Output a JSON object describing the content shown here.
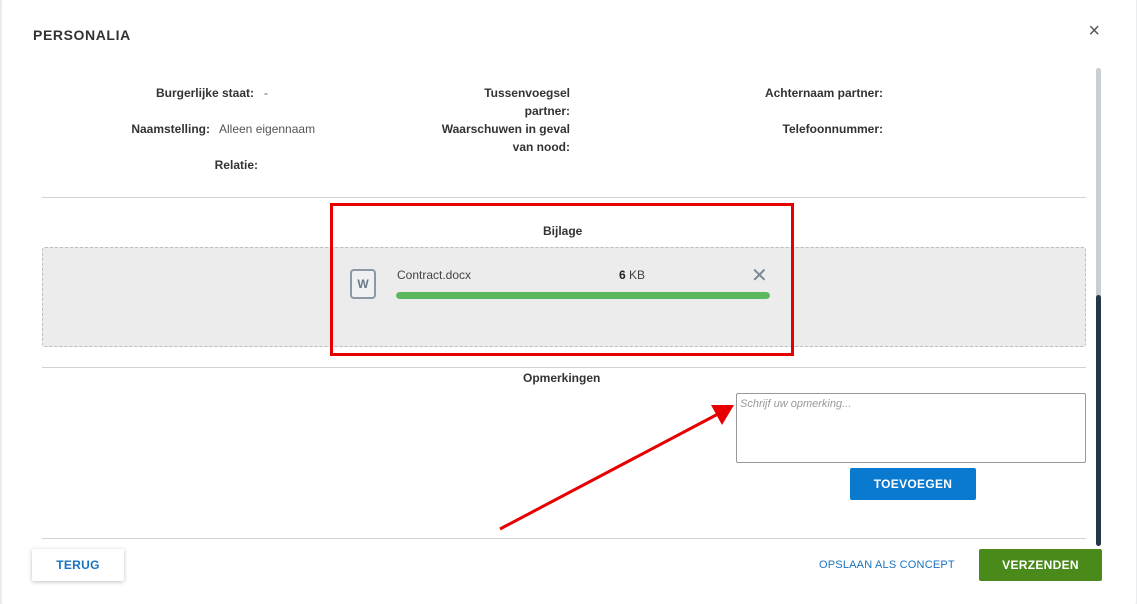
{
  "dialog": {
    "title": "PERSONALIA",
    "close_symbol": "×"
  },
  "fields": {
    "burgerlijke_staat": {
      "label": "Burgerlijke staat:",
      "value": "-"
    },
    "naamstelling": {
      "label": "Naamstelling:",
      "value": "Alleen eigennaam"
    },
    "relatie": {
      "label": "Relatie:",
      "value": ""
    },
    "tussenvoegsel_partner": {
      "label_line1": "Tussenvoegsel",
      "label_line2": "partner:"
    },
    "waarschuwen": {
      "label_line1": "Waarschuwen in geval",
      "label_line2": "van nood:"
    },
    "achternaam_partner": {
      "label": "Achternaam partner:"
    },
    "telefoonnummer": {
      "label": "Telefoonnummer:"
    }
  },
  "attachment": {
    "section_title": "Bijlage",
    "file_icon_letter": "W",
    "file_name": "Contract.docx",
    "file_size_value": "6",
    "file_size_unit": "KB",
    "remove_symbol": "✕",
    "progress_percent": 100,
    "progress_color": "#5cb85c"
  },
  "comments": {
    "section_title": "Opmerkingen",
    "placeholder": "Schrijf uw opmerking...",
    "add_button": "TOEVOEGEN"
  },
  "footer": {
    "back_button": "TERUG",
    "save_concept_link": "OPSLAAN ALS CONCEPT",
    "send_button": "VERZENDEN"
  },
  "colors": {
    "primary_blue": "#0a7ad0",
    "send_green": "#4a8a1a",
    "highlight_red": "#e60000"
  }
}
